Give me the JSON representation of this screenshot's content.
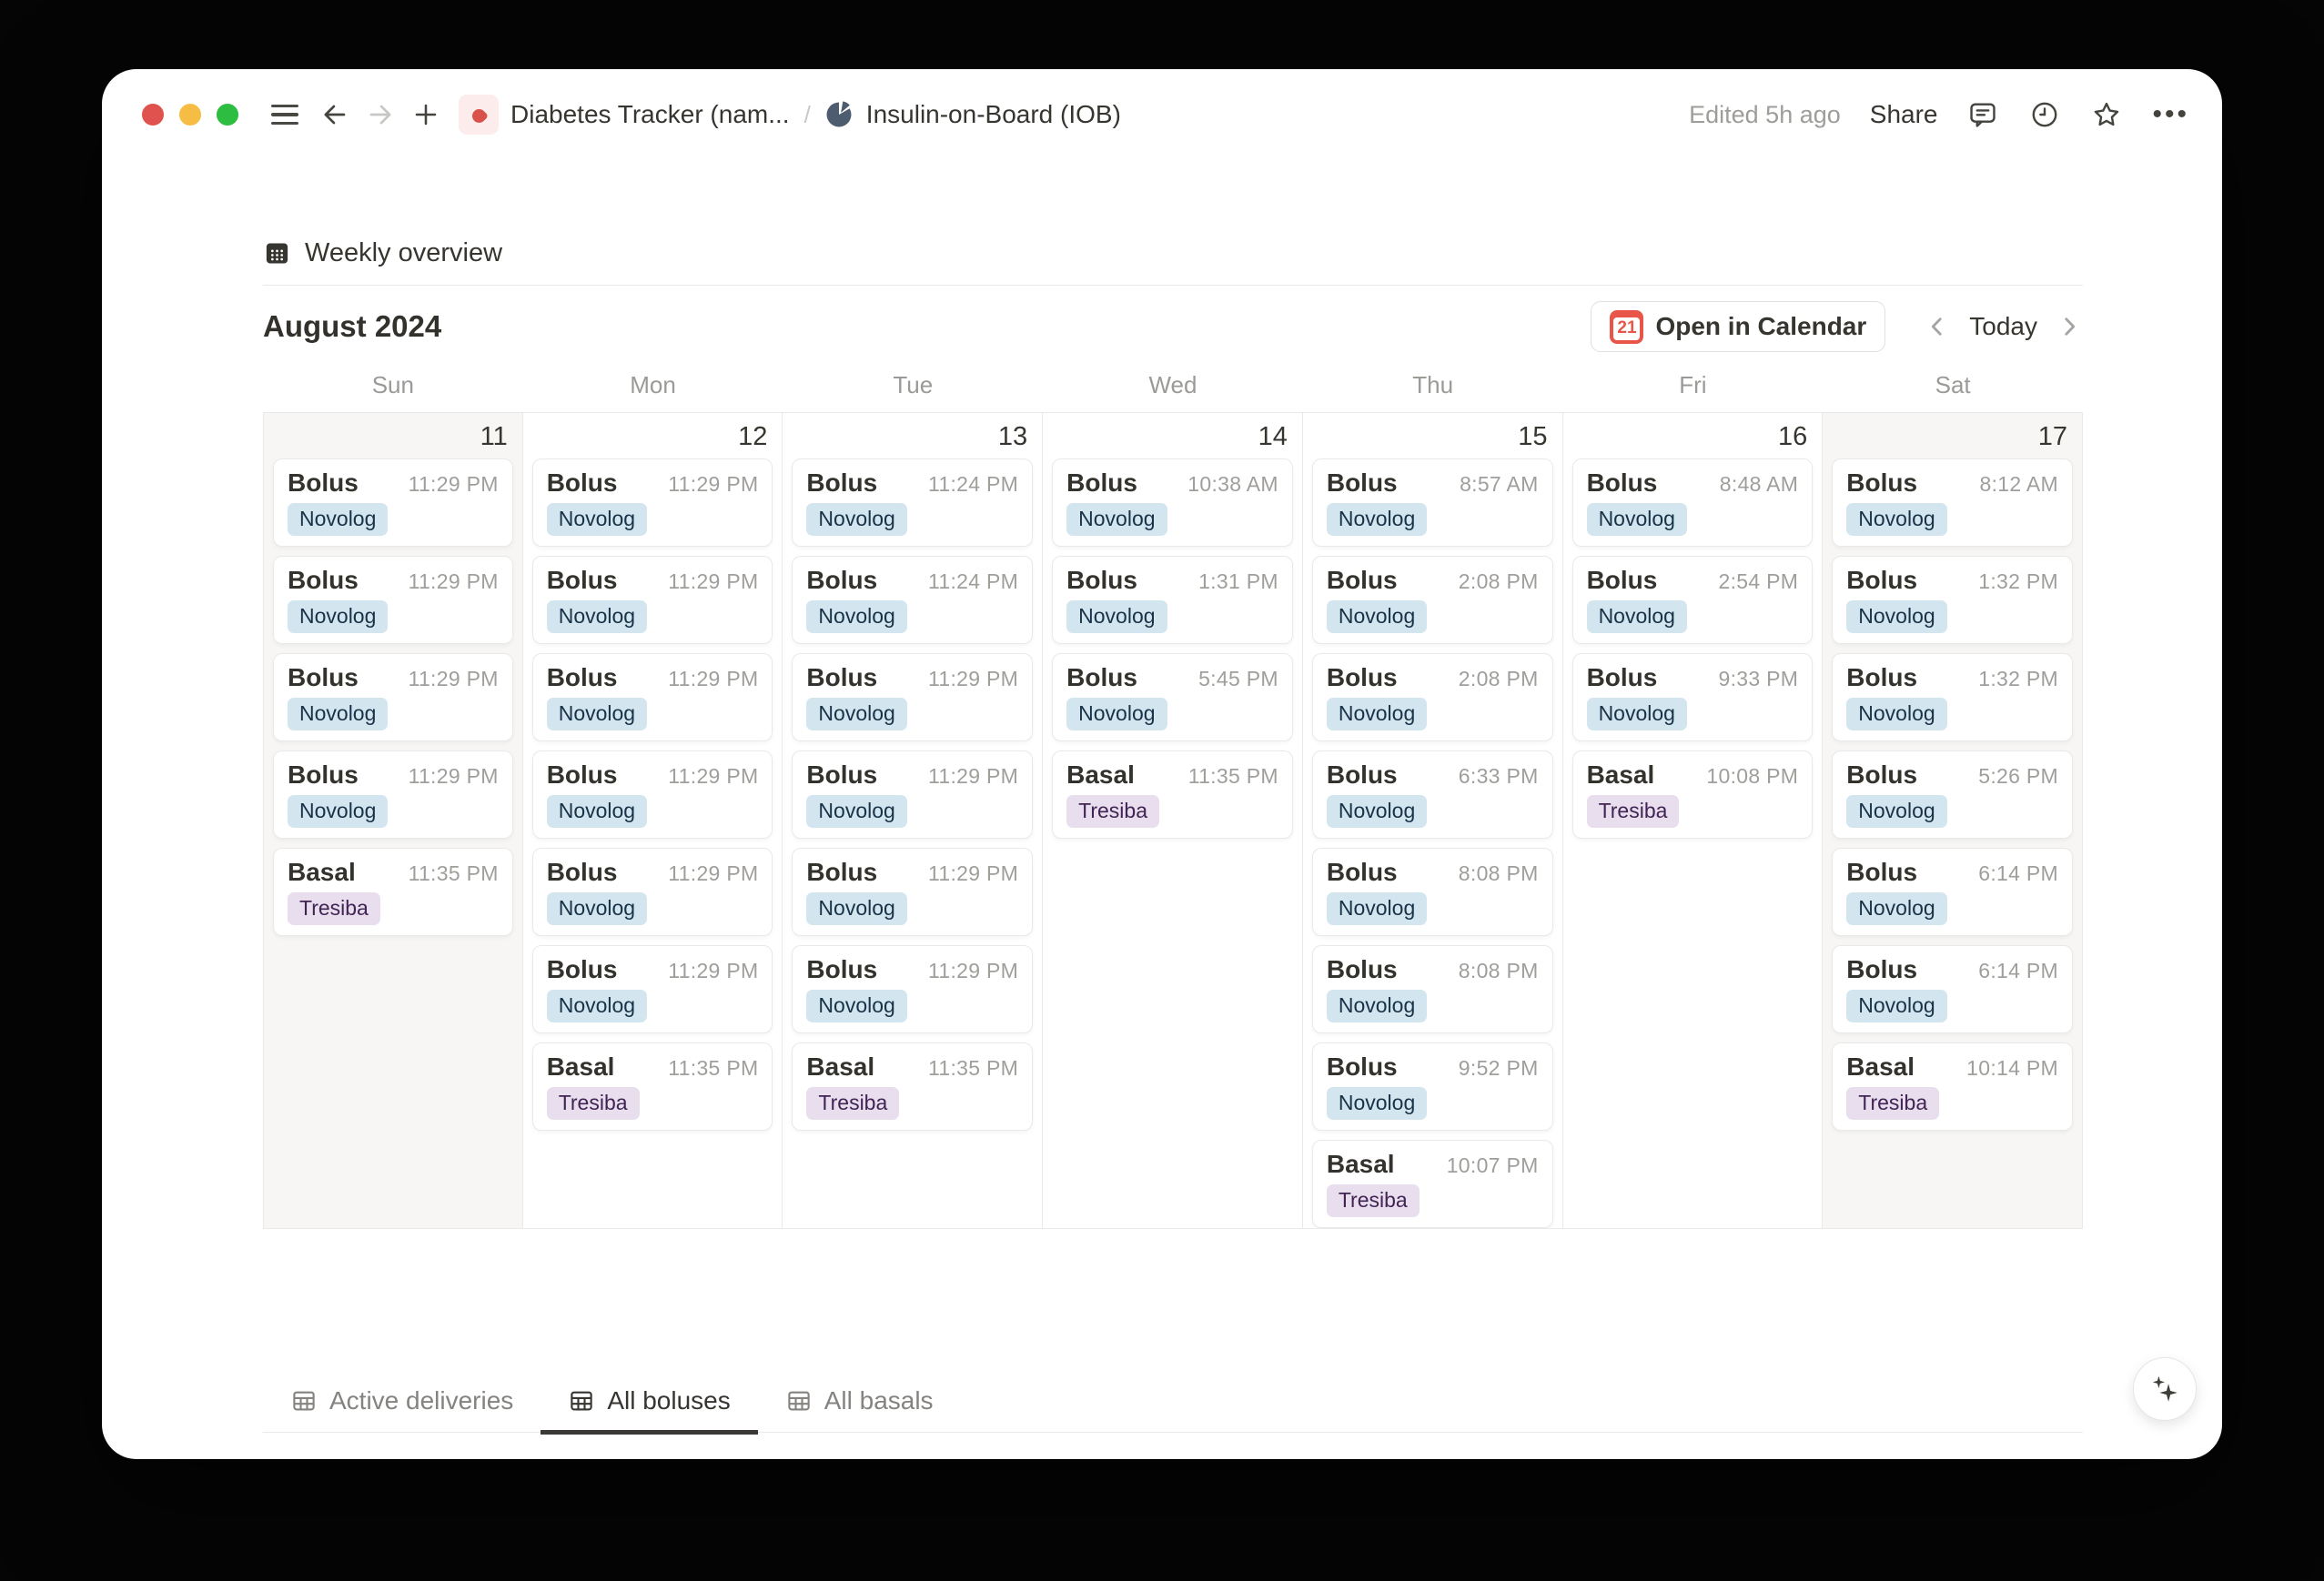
{
  "titlebar": {
    "breadcrumb_root": "Diabetes Tracker (nam...",
    "breadcrumb_separator": "/",
    "breadcrumb_page": "Insulin-on-Board (IOB)",
    "edited": "Edited 5h ago",
    "share_label": "Share"
  },
  "view": {
    "title": "Weekly overview",
    "month_label": "August 2024",
    "open_in_calendar_label": "Open in Calendar",
    "calendar_badge": "21",
    "today_label": "Today"
  },
  "calendar": {
    "day_headers": [
      "Sun",
      "Mon",
      "Tue",
      "Wed",
      "Thu",
      "Fri",
      "Sat"
    ],
    "days": [
      {
        "date": "11",
        "weekend": true,
        "events": [
          {
            "title": "Bolus",
            "time": "11:29 PM",
            "tag": "Novolog",
            "color": "blue"
          },
          {
            "title": "Bolus",
            "time": "11:29 PM",
            "tag": "Novolog",
            "color": "blue"
          },
          {
            "title": "Bolus",
            "time": "11:29 PM",
            "tag": "Novolog",
            "color": "blue"
          },
          {
            "title": "Bolus",
            "time": "11:29 PM",
            "tag": "Novolog",
            "color": "blue"
          },
          {
            "title": "Basal",
            "time": "11:35 PM",
            "tag": "Tresiba",
            "color": "purple"
          }
        ]
      },
      {
        "date": "12",
        "weekend": false,
        "events": [
          {
            "title": "Bolus",
            "time": "11:29 PM",
            "tag": "Novolog",
            "color": "blue"
          },
          {
            "title": "Bolus",
            "time": "11:29 PM",
            "tag": "Novolog",
            "color": "blue"
          },
          {
            "title": "Bolus",
            "time": "11:29 PM",
            "tag": "Novolog",
            "color": "blue"
          },
          {
            "title": "Bolus",
            "time": "11:29 PM",
            "tag": "Novolog",
            "color": "blue"
          },
          {
            "title": "Bolus",
            "time": "11:29 PM",
            "tag": "Novolog",
            "color": "blue"
          },
          {
            "title": "Bolus",
            "time": "11:29 PM",
            "tag": "Novolog",
            "color": "blue"
          },
          {
            "title": "Basal",
            "time": "11:35 PM",
            "tag": "Tresiba",
            "color": "purple"
          }
        ]
      },
      {
        "date": "13",
        "weekend": false,
        "events": [
          {
            "title": "Bolus",
            "time": "11:24 PM",
            "tag": "Novolog",
            "color": "blue"
          },
          {
            "title": "Bolus",
            "time": "11:24 PM",
            "tag": "Novolog",
            "color": "blue"
          },
          {
            "title": "Bolus",
            "time": "11:29 PM",
            "tag": "Novolog",
            "color": "blue"
          },
          {
            "title": "Bolus",
            "time": "11:29 PM",
            "tag": "Novolog",
            "color": "blue"
          },
          {
            "title": "Bolus",
            "time": "11:29 PM",
            "tag": "Novolog",
            "color": "blue"
          },
          {
            "title": "Bolus",
            "time": "11:29 PM",
            "tag": "Novolog",
            "color": "blue"
          },
          {
            "title": "Basal",
            "time": "11:35 PM",
            "tag": "Tresiba",
            "color": "purple"
          }
        ]
      },
      {
        "date": "14",
        "weekend": false,
        "events": [
          {
            "title": "Bolus",
            "time": "10:38 AM",
            "tag": "Novolog",
            "color": "blue"
          },
          {
            "title": "Bolus",
            "time": "1:31 PM",
            "tag": "Novolog",
            "color": "blue"
          },
          {
            "title": "Bolus",
            "time": "5:45 PM",
            "tag": "Novolog",
            "color": "blue"
          },
          {
            "title": "Basal",
            "time": "11:35 PM",
            "tag": "Tresiba",
            "color": "purple"
          }
        ]
      },
      {
        "date": "15",
        "weekend": false,
        "events": [
          {
            "title": "Bolus",
            "time": "8:57 AM",
            "tag": "Novolog",
            "color": "blue"
          },
          {
            "title": "Bolus",
            "time": "2:08 PM",
            "tag": "Novolog",
            "color": "blue"
          },
          {
            "title": "Bolus",
            "time": "2:08 PM",
            "tag": "Novolog",
            "color": "blue"
          },
          {
            "title": "Bolus",
            "time": "6:33 PM",
            "tag": "Novolog",
            "color": "blue"
          },
          {
            "title": "Bolus",
            "time": "8:08 PM",
            "tag": "Novolog",
            "color": "blue"
          },
          {
            "title": "Bolus",
            "time": "8:08 PM",
            "tag": "Novolog",
            "color": "blue"
          },
          {
            "title": "Bolus",
            "time": "9:52 PM",
            "tag": "Novolog",
            "color": "blue"
          },
          {
            "title": "Basal",
            "time": "10:07 PM",
            "tag": "Tresiba",
            "color": "purple"
          }
        ]
      },
      {
        "date": "16",
        "weekend": false,
        "events": [
          {
            "title": "Bolus",
            "time": "8:48 AM",
            "tag": "Novolog",
            "color": "blue"
          },
          {
            "title": "Bolus",
            "time": "2:54 PM",
            "tag": "Novolog",
            "color": "blue"
          },
          {
            "title": "Bolus",
            "time": "9:33 PM",
            "tag": "Novolog",
            "color": "blue"
          },
          {
            "title": "Basal",
            "time": "10:08 PM",
            "tag": "Tresiba",
            "color": "purple"
          }
        ]
      },
      {
        "date": "17",
        "weekend": true,
        "events": [
          {
            "title": "Bolus",
            "time": "8:12 AM",
            "tag": "Novolog",
            "color": "blue"
          },
          {
            "title": "Bolus",
            "time": "1:32 PM",
            "tag": "Novolog",
            "color": "blue"
          },
          {
            "title": "Bolus",
            "time": "1:32 PM",
            "tag": "Novolog",
            "color": "blue"
          },
          {
            "title": "Bolus",
            "time": "5:26 PM",
            "tag": "Novolog",
            "color": "blue"
          },
          {
            "title": "Bolus",
            "time": "6:14 PM",
            "tag": "Novolog",
            "color": "blue"
          },
          {
            "title": "Bolus",
            "time": "6:14 PM",
            "tag": "Novolog",
            "color": "blue"
          },
          {
            "title": "Basal",
            "time": "10:14 PM",
            "tag": "Tresiba",
            "color": "purple"
          }
        ]
      }
    ]
  },
  "tabs": [
    {
      "label": "Active deliveries",
      "active": false
    },
    {
      "label": "All boluses",
      "active": true
    },
    {
      "label": "All basals",
      "active": false
    }
  ],
  "colors": {
    "tag_blue": {
      "bg": "#d3e5ef",
      "text": "#183347"
    },
    "tag_purple": {
      "bg": "#e8deee",
      "text": "#412454"
    },
    "calendar_red": "#e8564a",
    "traffic_red": "#e0524d",
    "traffic_yellow": "#f6bd45",
    "traffic_green": "#2dbd41",
    "weekend_bg": "#f7f6f4"
  }
}
